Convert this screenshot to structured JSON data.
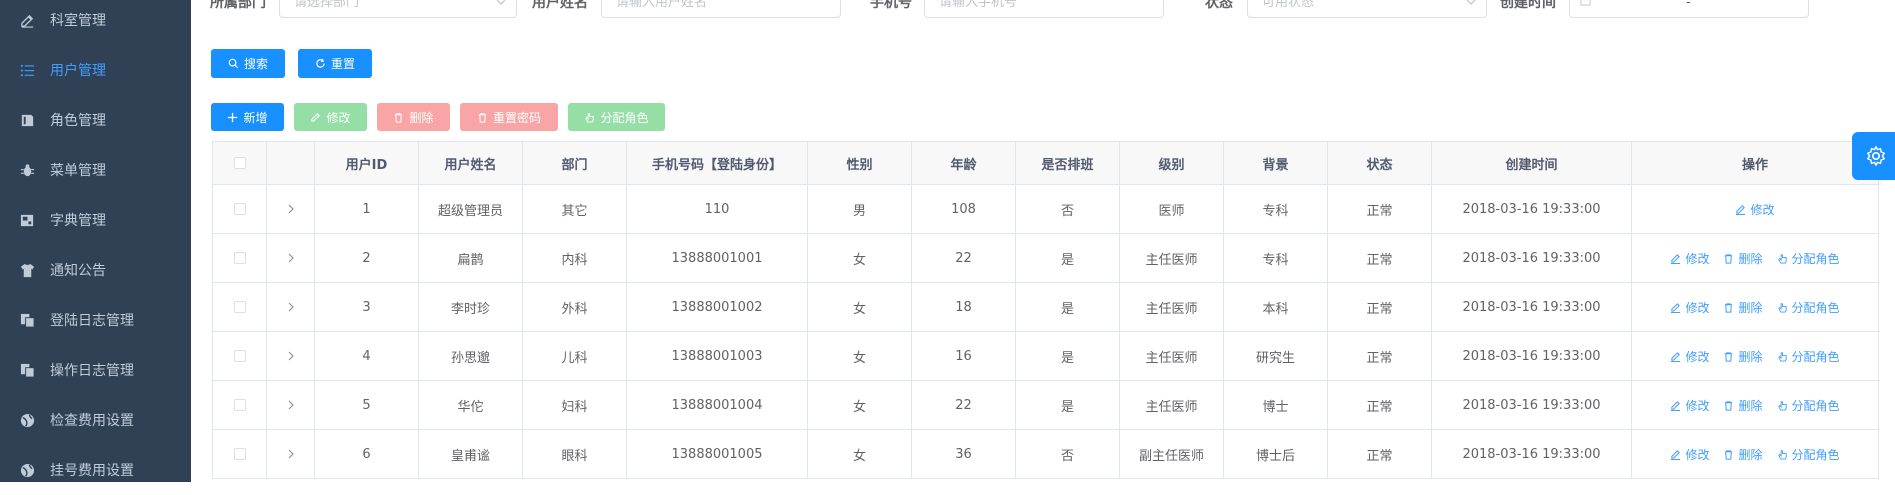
{
  "sidebar": {
    "items": [
      {
        "label": "科室管理",
        "icon": "edit-icon",
        "active": false
      },
      {
        "label": "用户管理",
        "icon": "list-icon",
        "active": true
      },
      {
        "label": "角色管理",
        "icon": "book-icon",
        "active": false
      },
      {
        "label": "菜单管理",
        "icon": "bug-icon",
        "active": false
      },
      {
        "label": "字典管理",
        "icon": "dict-icon",
        "active": false
      },
      {
        "label": "通知公告",
        "icon": "shirt-icon",
        "active": false
      },
      {
        "label": "登陆日志管理",
        "icon": "copy-icon",
        "active": false
      },
      {
        "label": "操作日志管理",
        "icon": "copy-icon",
        "active": false
      },
      {
        "label": "检查费用设置",
        "icon": "globe-icon",
        "active": false
      },
      {
        "label": "挂号费用设置",
        "icon": "globe-icon",
        "active": false
      }
    ]
  },
  "search": {
    "dept_label": "所属部门",
    "dept_placeholder": "请选择部门",
    "name_label": "用户姓名",
    "name_placeholder": "请输入用户姓名",
    "phone_label": "手机号",
    "phone_placeholder": "请输入手机号",
    "status_label": "状态",
    "status_placeholder": "可用状态",
    "created_label": "创建时间",
    "date_separator": "-",
    "search_button": "搜索",
    "reset_button": "重置"
  },
  "toolbar": {
    "add": "新增",
    "edit": "修改",
    "delete": "删除",
    "reset_password": "重置密码",
    "assign_role": "分配角色"
  },
  "table": {
    "headers": [
      "用户ID",
      "用户姓名",
      "部门",
      "手机号码【登陆身份】",
      "性别",
      "年龄",
      "是否排班",
      "级别",
      "背景",
      "状态",
      "创建时间",
      "操作"
    ],
    "rows": [
      [
        "1",
        "超级管理员",
        "其它",
        "110",
        "男",
        "108",
        "否",
        "医师",
        "专科",
        "正常",
        "2018-03-16 19:33:00"
      ],
      [
        "2",
        "扁鹊",
        "内科",
        "13888001001",
        "女",
        "22",
        "是",
        "主任医师",
        "专科",
        "正常",
        "2018-03-16 19:33:00"
      ],
      [
        "3",
        "李时珍",
        "外科",
        "13888001002",
        "女",
        "18",
        "是",
        "主任医师",
        "本科",
        "正常",
        "2018-03-16 19:33:00"
      ],
      [
        "4",
        "孙思邈",
        "儿科",
        "13888001003",
        "女",
        "16",
        "是",
        "主任医师",
        "研究生",
        "正常",
        "2018-03-16 19:33:00"
      ],
      [
        "5",
        "华佗",
        "妇科",
        "13888001004",
        "女",
        "22",
        "是",
        "主任医师",
        "博士",
        "正常",
        "2018-03-16 19:33:00"
      ],
      [
        "6",
        "皇甫谧",
        "眼科",
        "13888001005",
        "女",
        "36",
        "否",
        "副主任医师",
        "博士后",
        "正常",
        "2018-03-16 19:33:00"
      ]
    ],
    "op_edit": "修改",
    "op_delete": "删除",
    "op_assign": "分配角色"
  },
  "colors": {
    "sidebar_bg": "#304156",
    "active": "#409eff",
    "primary": "#1890ff"
  }
}
